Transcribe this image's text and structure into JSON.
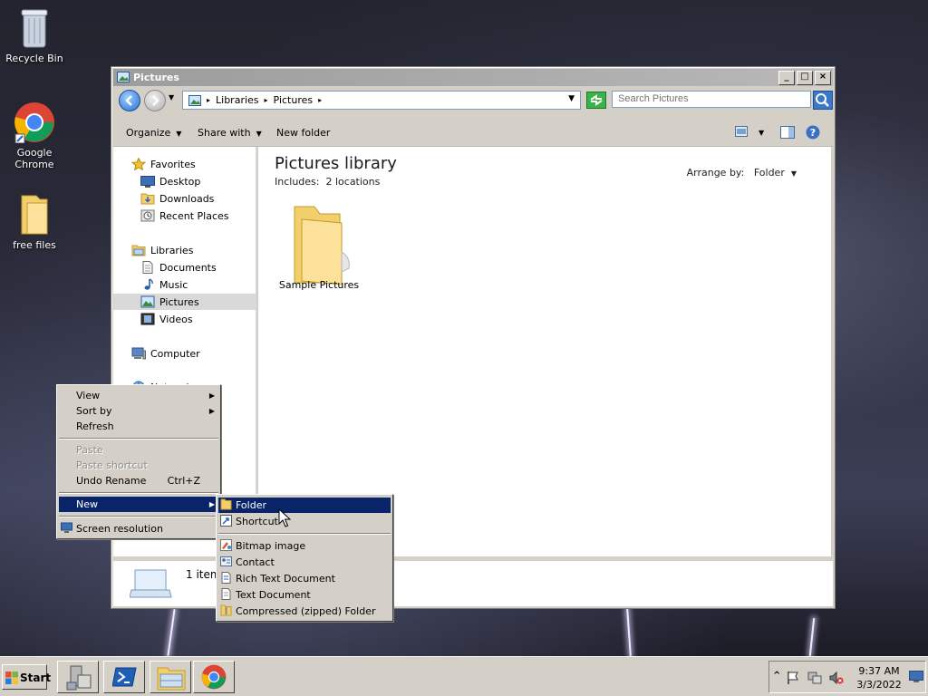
{
  "desktop": {
    "icons": [
      {
        "label": "Recycle Bin"
      },
      {
        "label": "Google Chrome"
      },
      {
        "label": "free files"
      }
    ]
  },
  "window": {
    "title": "Pictures",
    "address": {
      "crumbs": [
        "Libraries",
        "Pictures"
      ]
    },
    "search_placeholder": "Search Pictures",
    "toolbar": {
      "organize": "Organize",
      "share_with": "Share with",
      "new_folder": "New folder"
    },
    "nav": {
      "favorites": "Favorites",
      "desktop": "Desktop",
      "downloads": "Downloads",
      "recent_places": "Recent Places",
      "libraries": "Libraries",
      "documents": "Documents",
      "music": "Music",
      "pictures": "Pictures",
      "videos": "Videos",
      "computer": "Computer",
      "network": "Network"
    },
    "content": {
      "title": "Pictures library",
      "includes_label": "Includes:",
      "includes_value": "2 locations",
      "arrange_label": "Arrange by:",
      "arrange_value": "Folder",
      "items": [
        {
          "label": "Sample Pictures"
        }
      ]
    },
    "details": {
      "count": "1 item"
    }
  },
  "context_menu": {
    "items": {
      "view": "View",
      "sort_by": "Sort by",
      "refresh": "Refresh",
      "paste": "Paste",
      "paste_shortcut": "Paste shortcut",
      "undo_rename": "Undo Rename",
      "undo_rename_shortcut": "Ctrl+Z",
      "new": "New",
      "screen_resolution": "Screen resolution"
    }
  },
  "new_submenu": {
    "items": {
      "folder": "Folder",
      "shortcut": "Shortcut",
      "bitmap": "Bitmap image",
      "contact": "Contact",
      "rtf": "Rich Text Document",
      "text": "Text Document",
      "zip": "Compressed (zipped) Folder"
    }
  },
  "taskbar": {
    "start_label": "Start",
    "clock_time": "9:37 AM",
    "clock_date": "3/3/2022"
  }
}
